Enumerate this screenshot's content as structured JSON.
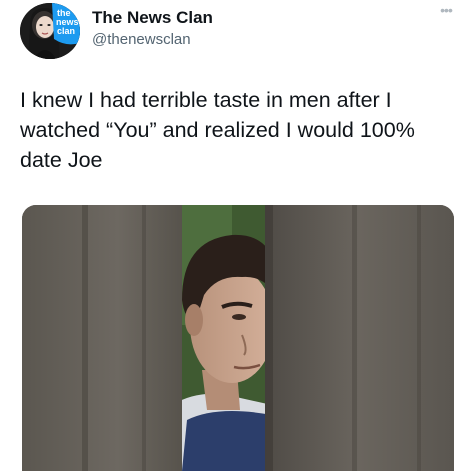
{
  "author": {
    "display_name": "The News Clan",
    "handle": "@thenewsclan",
    "avatar_logo_text": [
      "the",
      "news",
      "clan"
    ]
  },
  "more_icon": "more-dots-icon",
  "tweet": {
    "text": "I knew I had terrible taste in men after I watched “You” and realized I would 100% date Joe"
  },
  "media": {
    "description_icon": "photo",
    "colors": {
      "fence": "#6a655e",
      "fence_dark": "#4e4a45",
      "foliage": "#3d5a2e",
      "skin": "#c9a48c",
      "hair": "#2a1f1a",
      "shirt": "#2c3e6b"
    }
  },
  "colors": {
    "text": "#0f1419",
    "secondary": "#536471",
    "avatar_badge": "#1d9bf0"
  }
}
